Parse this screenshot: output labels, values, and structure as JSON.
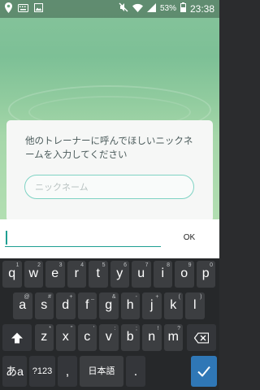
{
  "status_bar": {
    "icons_left": [
      "location-pin-icon",
      "keyboard-icon",
      "image-icon"
    ],
    "icons_right": [
      "mute-icon",
      "wifi-icon",
      "signal-icon",
      "battery-icon"
    ],
    "battery": "53%",
    "time": "23:38"
  },
  "dialog": {
    "prompt": "他のトレーナーに呼んでほしいニックネームを入力してください",
    "input_placeholder": "ニックネーム"
  },
  "entry": {
    "value": "",
    "ok_label": "OK"
  },
  "keyboard": {
    "row1": [
      {
        "key": "q",
        "hint": "1"
      },
      {
        "key": "w",
        "hint": "2"
      },
      {
        "key": "e",
        "hint": "3"
      },
      {
        "key": "r",
        "hint": "4"
      },
      {
        "key": "t",
        "hint": "5"
      },
      {
        "key": "y",
        "hint": "6"
      },
      {
        "key": "u",
        "hint": "7"
      },
      {
        "key": "i",
        "hint": "8"
      },
      {
        "key": "o",
        "hint": "9"
      },
      {
        "key": "p",
        "hint": "0"
      }
    ],
    "row2": [
      {
        "key": "a",
        "hint": "@"
      },
      {
        "key": "s",
        "hint": "#"
      },
      {
        "key": "d",
        "hint": "+"
      },
      {
        "key": "f",
        "hint": "_"
      },
      {
        "key": "g",
        "hint": "&"
      },
      {
        "key": "h",
        "hint": "-"
      },
      {
        "key": "j",
        "hint": "+"
      },
      {
        "key": "k",
        "hint": "("
      },
      {
        "key": "l",
        "hint": ")"
      }
    ],
    "row3": [
      {
        "key": "z",
        "hint": "*"
      },
      {
        "key": "x",
        "hint": "\""
      },
      {
        "key": "c",
        "hint": "'"
      },
      {
        "key": "v",
        "hint": ":"
      },
      {
        "key": "b",
        "hint": ";"
      },
      {
        "key": "n",
        "hint": "!"
      },
      {
        "key": "m",
        "hint": "?"
      }
    ],
    "shift_icon": "shift-icon",
    "backspace_icon": "backspace-icon",
    "lang_toggle": "あa",
    "symbols": "?123",
    "comma": ",",
    "space_label": "日本語",
    "period": ".",
    "enter_icon": "checkmark-icon"
  }
}
